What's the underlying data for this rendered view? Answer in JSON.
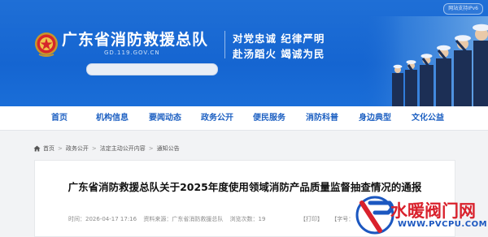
{
  "header": {
    "ipv6_badge": "网站支持IPv6",
    "site_title": "广东省消防救援总队",
    "site_domain": "GD.119.GOV.CN",
    "slogan_line1": "对党忠诚 纪律严明",
    "slogan_line2": "赴汤蹈火 竭诚为民",
    "colors": {
      "primary": "#1565d1",
      "nav_text": "#1d60c2"
    }
  },
  "nav": {
    "items": [
      "首页",
      "机构信息",
      "要闻动态",
      "政务公开",
      "便民服务",
      "消防科普",
      "身边典型",
      "文化公益"
    ]
  },
  "breadcrumb": {
    "icon": "home-icon",
    "items": [
      "首页",
      "政务公开",
      "法定主动公开内容",
      "通知公告"
    ],
    "separator": ">"
  },
  "article": {
    "title": "广东省消防救援总队关于2025年度使用领域消防产品质量监督抽查情况的通报",
    "date": "时间：2026-04-17 17:16",
    "source": "资料来源：广东省消防救援总队",
    "views": "浏览次数：19",
    "print": "【打印】",
    "font_size": "【字号："
  },
  "watermark": {
    "brand_cn": "水暖阀门网",
    "brand_en": "WWW.PVCPU.COM"
  }
}
